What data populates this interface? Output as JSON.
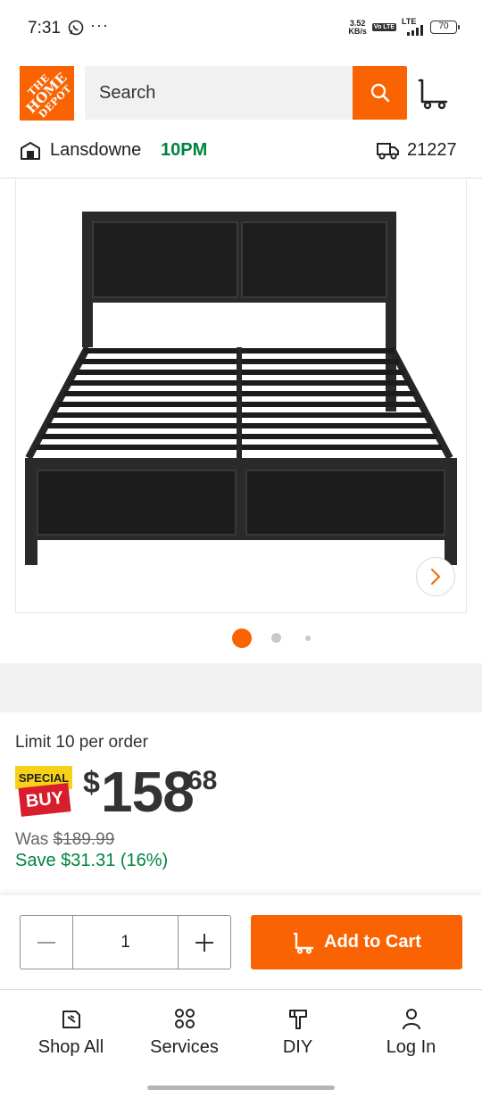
{
  "status_bar": {
    "time": "7:31",
    "more": "···",
    "speed_top": "3.52",
    "speed_unit": "KB/s",
    "volte": "Vo LTE",
    "network": "LTE",
    "battery": "70"
  },
  "header": {
    "logo_line1": "THE",
    "logo_line2": "HOME",
    "logo_line3": "DEPOT",
    "search_placeholder": "Search"
  },
  "store": {
    "name": "Lansdowne",
    "hours": "10PM",
    "zip": "21227"
  },
  "gallery": {
    "image_alt": "Black metal platform bed frame with wood-panel headboard and footboard",
    "active_index": 0,
    "total": 3,
    "accent": "#f96302"
  },
  "pricing": {
    "limit": "Limit 10 per order",
    "badge_top": "SPECIAL",
    "badge_bottom": "BUY",
    "currency": "$",
    "dollars": "158",
    "cents": "68",
    "was_label": "Was",
    "was_price": "$189.99",
    "save": "Save $31.31 (16%)"
  },
  "cart": {
    "quantity": "1",
    "add_label": "Add to Cart"
  },
  "nav": {
    "items": [
      {
        "label": "Shop All",
        "icon": "shop-all-icon"
      },
      {
        "label": "Services",
        "icon": "services-icon"
      },
      {
        "label": "DIY",
        "icon": "diy-icon"
      },
      {
        "label": "Log In",
        "icon": "user-icon"
      }
    ]
  },
  "colors": {
    "brand_orange": "#f96302",
    "price_green": "#00843d",
    "special_yellow": "#f7d117",
    "special_red": "#d81e2c"
  }
}
